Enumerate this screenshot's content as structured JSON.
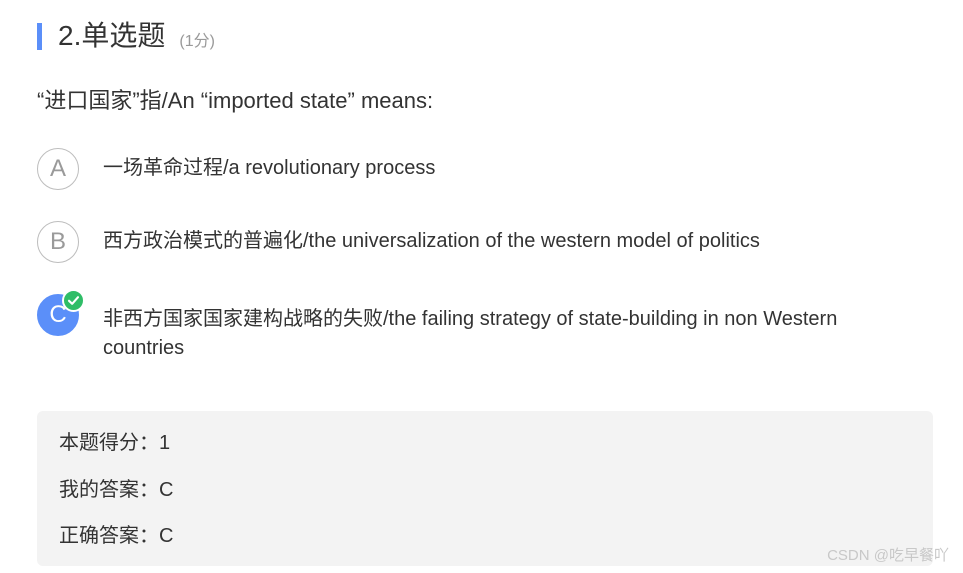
{
  "header": {
    "title": "2.单选题",
    "score": "(1分)"
  },
  "question": {
    "text": "“进口国家”指/An “imported state” means:"
  },
  "options": [
    {
      "letter": "A",
      "text": "一场革命过程/a revolutionary process",
      "selected": false
    },
    {
      "letter": "B",
      "text": "西方政治模式的普遍化/the universalization of the western model of politics",
      "selected": false
    },
    {
      "letter": "C",
      "text": "非西方国家国家建构战略的失败/the failing strategy of state-building in non Western countries",
      "selected": true,
      "icon": "check-icon"
    }
  ],
  "result": {
    "score_line": "本题得分：1",
    "my_answer_line": "我的答案：C",
    "correct_answer_line": "正确答案：C"
  },
  "watermark": "CSDN @吃早餐吖",
  "colors": {
    "accent": "#5b8ff9",
    "correct": "#2fbd67",
    "panel": "#f3f3f3"
  }
}
